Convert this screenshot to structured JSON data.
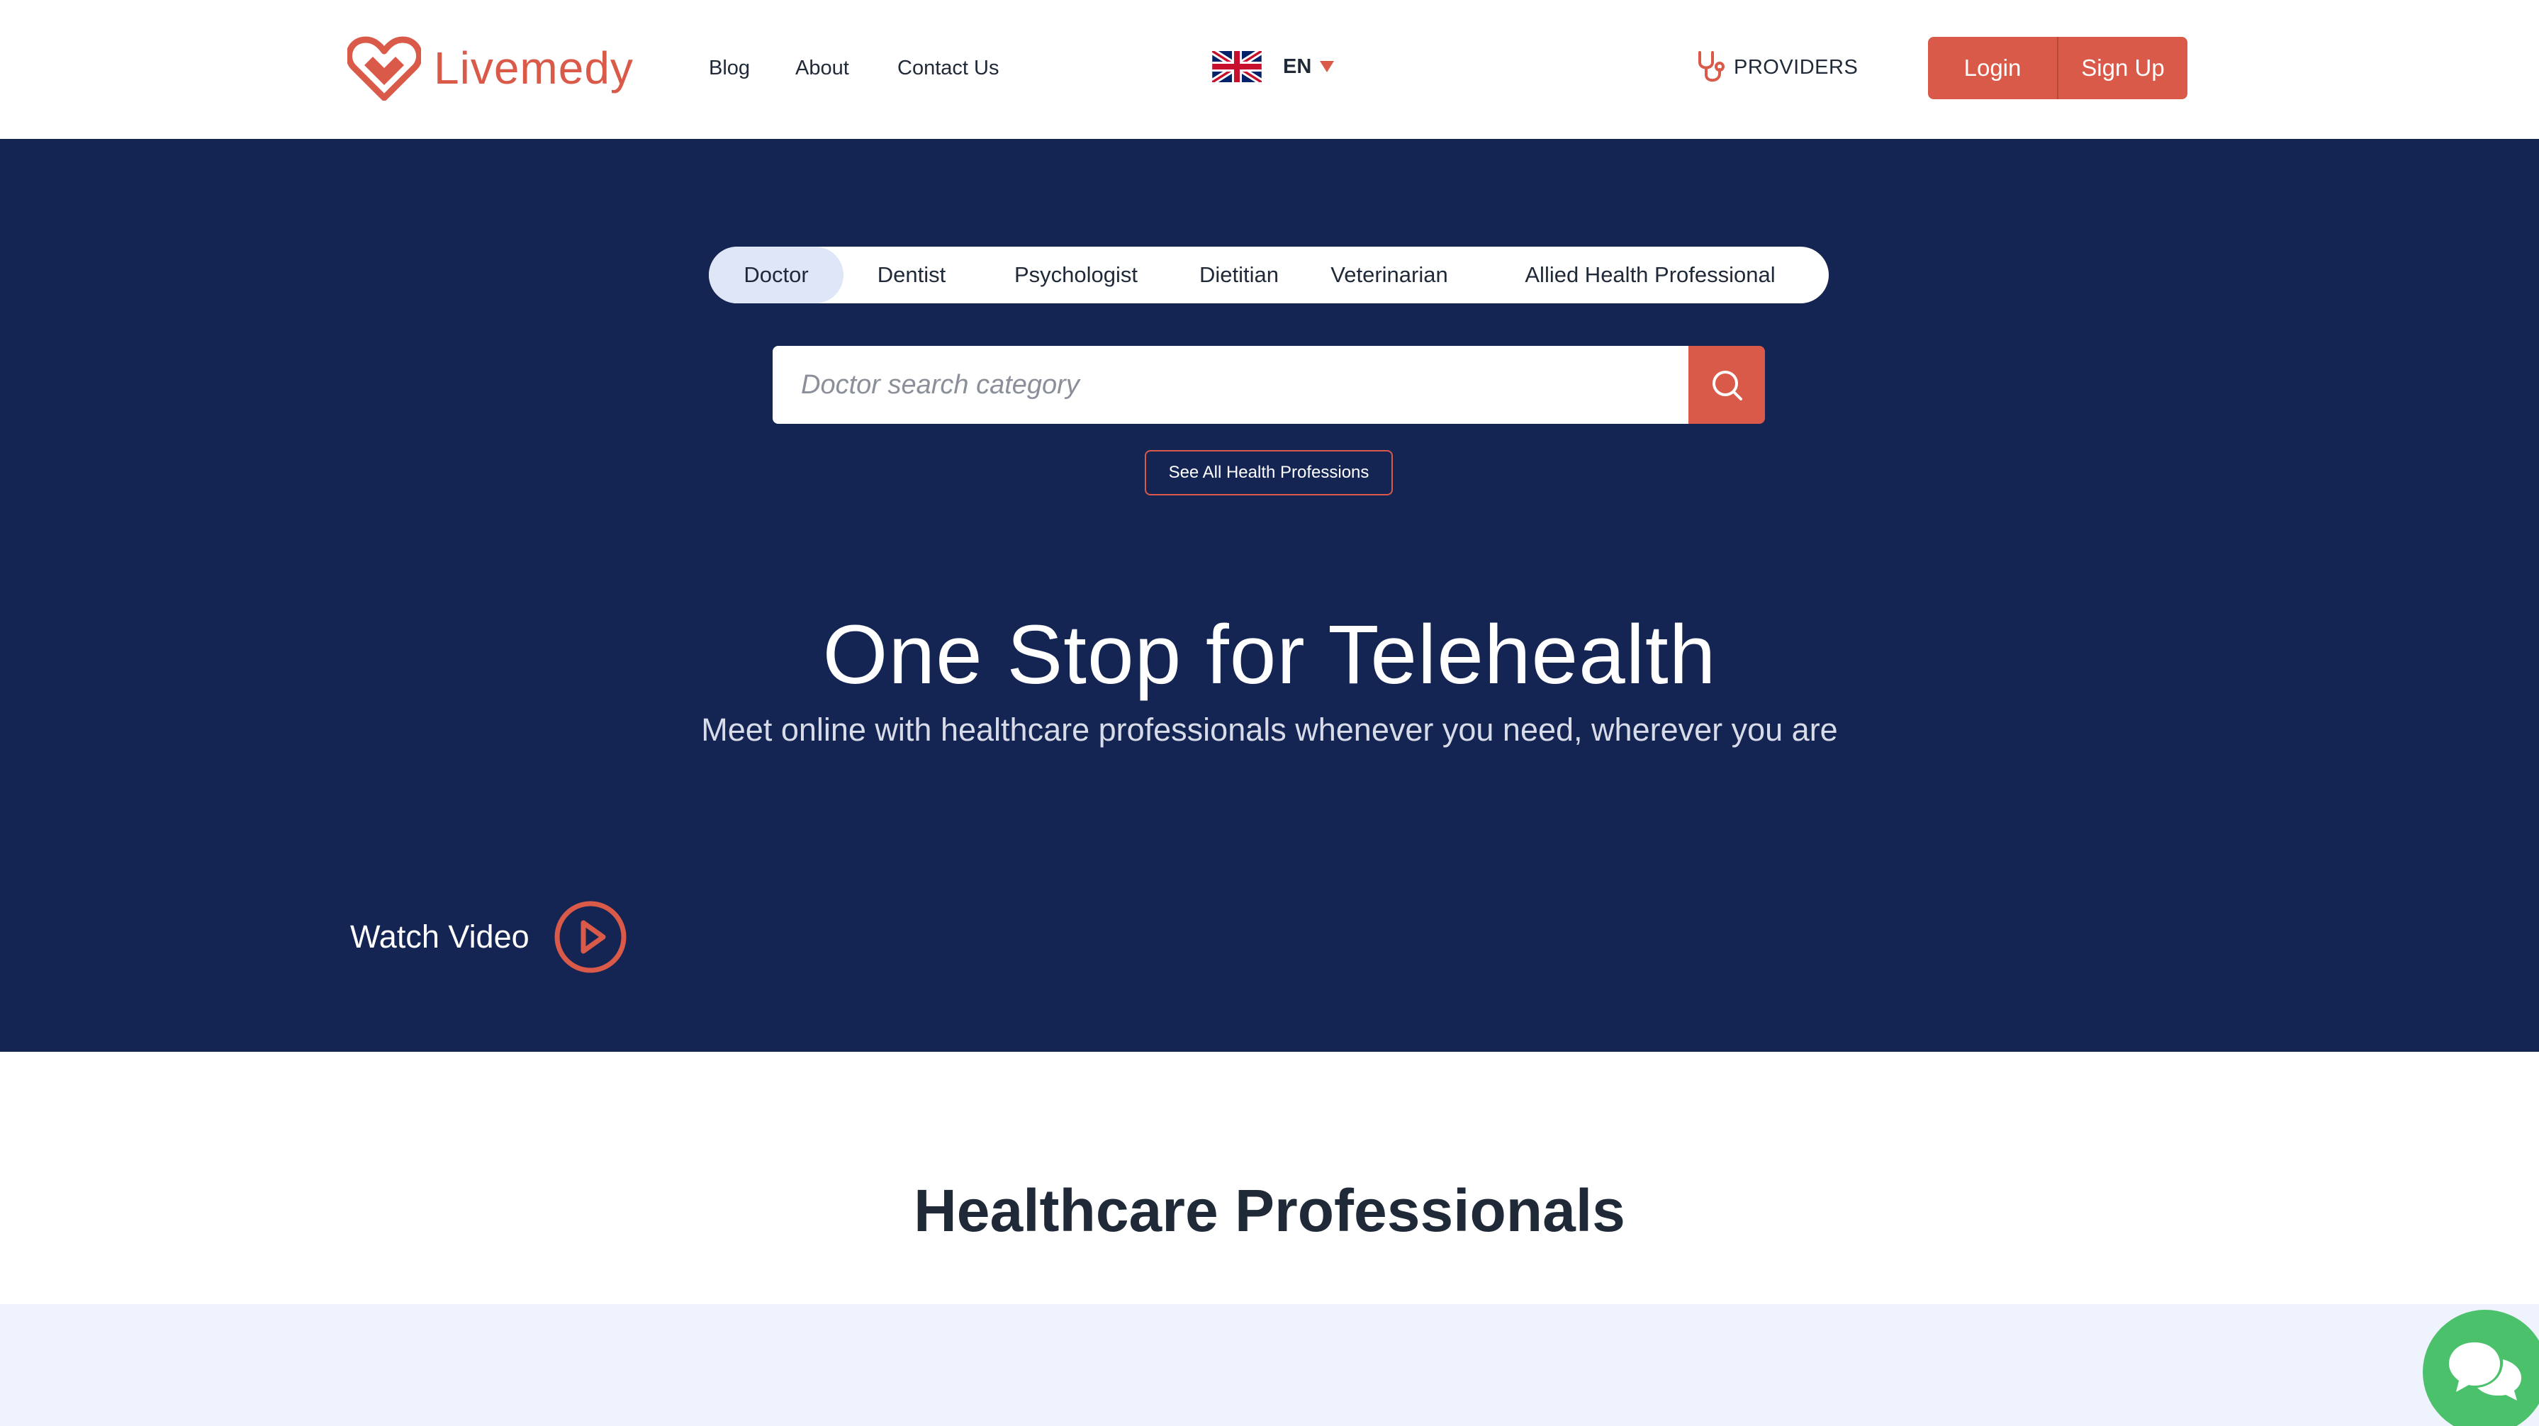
{
  "header": {
    "logo_text": "Livemedy",
    "nav": [
      "Blog",
      "About",
      "Contact Us"
    ],
    "language": "EN",
    "flag_icon": "uk-flag-icon",
    "providers_label": "PROVIDERS",
    "providers_icon": "stethoscope-icon",
    "login_label": "Login",
    "signup_label": "Sign Up"
  },
  "hero": {
    "tabs": [
      "Doctor",
      "Dentist",
      "Psychologist",
      "Dietitian",
      "Veterinarian",
      "Allied Health Professional"
    ],
    "active_tab": "Doctor",
    "search_placeholder": "Doctor search category",
    "search_icon": "search-icon",
    "see_all_label": "See All Health Professions",
    "title": "One Stop for Telehealth",
    "subtitle": "Meet online with healthcare professionals whenever you need, wherever you are",
    "watch_video_label": "Watch Video",
    "play_icon": "play-circle-icon"
  },
  "section": {
    "title": "Healthcare Professionals"
  },
  "chat_icon": "chat-bubbles-icon",
  "colors": {
    "brand": "#d95a48",
    "hero_bg": "#152553",
    "band_bg": "#eef3fd",
    "chat_bg": "#4cc16b",
    "active_tab_bg": "#dfe6f7"
  }
}
